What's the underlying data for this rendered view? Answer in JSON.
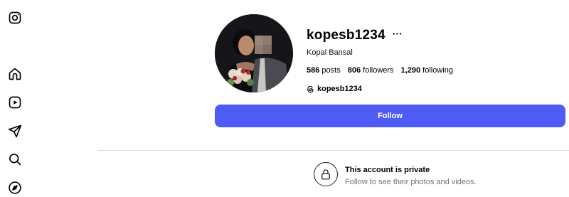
{
  "nav": {
    "icons": [
      "instagram-icon",
      "home-icon",
      "reels-icon",
      "messages-icon",
      "search-icon",
      "explore-icon"
    ]
  },
  "profile": {
    "username": "kopesb1234",
    "more": "···",
    "full_name": "Kopal Bansal",
    "stats": [
      {
        "count": "586",
        "label": "posts"
      },
      {
        "count": "806",
        "label": "followers"
      },
      {
        "count": "1,290",
        "label": "following"
      }
    ],
    "threads_handle": "kopesb1234"
  },
  "follow_button": {
    "label": "Follow",
    "color": "#4f5bf5"
  },
  "private": {
    "title": "This account is private",
    "subtitle": "Follow to see their photos and videos."
  }
}
